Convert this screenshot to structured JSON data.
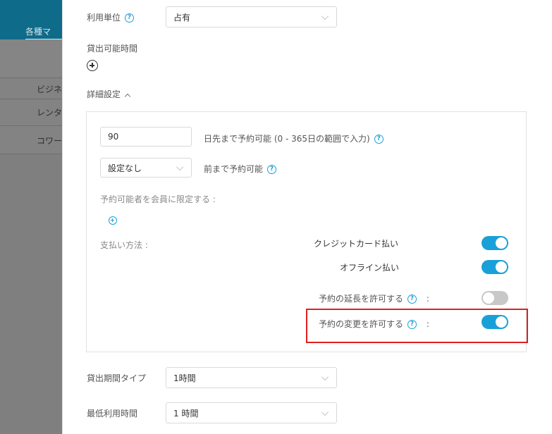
{
  "background": {
    "tab_label": "各種マ",
    "rows": [
      {
        "text": "ビジネ"
      },
      {
        "text": "レンタ"
      },
      {
        "text": "コワー"
      }
    ]
  },
  "form": {
    "usage_unit": {
      "label": "利用単位",
      "value": "占有"
    },
    "rental_hours": {
      "label": "貸出可能時間"
    },
    "advanced_settings": {
      "label": "詳細設定"
    },
    "advance_booking": {
      "value": "90",
      "suffix": "日先まで予約可能 (0 - 365日の範囲で入力)"
    },
    "booking_deadline": {
      "value": "設定なし",
      "suffix": "前まで予約可能"
    },
    "member_limit": {
      "label": "予約可能者を会員に限定する :"
    },
    "payment": {
      "label": "支払い方法 :",
      "credit_card": {
        "label": "クレジットカード払い",
        "enabled": true
      },
      "offline": {
        "label": "オフライン払い",
        "enabled": true
      }
    },
    "allow_extension": {
      "label": "予約の延長を許可する",
      "colon": ":",
      "enabled": false
    },
    "allow_change": {
      "label": "予約の変更を許可する",
      "colon": ":",
      "enabled": true
    },
    "rental_period_type": {
      "label": "貸出期間タイプ",
      "value": "1時間"
    },
    "min_usage_time": {
      "label": "最低利用時間",
      "value": "1 時間"
    }
  },
  "colors": {
    "accent": "#1aa0d8",
    "highlight": "#e02020"
  }
}
